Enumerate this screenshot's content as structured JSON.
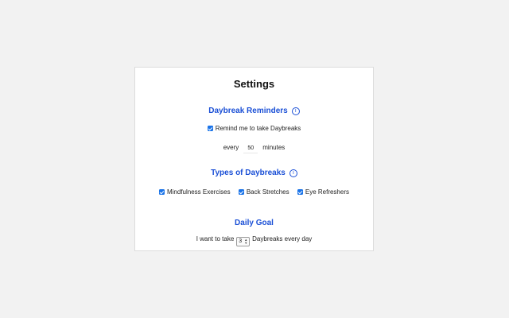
{
  "settings": {
    "title": "Settings",
    "reminders": {
      "heading": "Daybreak Reminders",
      "remind_label": "Remind me to take Daybreaks",
      "remind_checked": true,
      "every_label": "every",
      "minutes_value": "50",
      "minutes_label": "minutes"
    },
    "types": {
      "heading": "Types of Daybreaks",
      "items": [
        {
          "label": "Mindfulness Exercises",
          "checked": true
        },
        {
          "label": "Back Stretches",
          "checked": true
        },
        {
          "label": "Eye Refreshers",
          "checked": true
        }
      ]
    },
    "goal": {
      "heading": "Daily Goal",
      "prefix": "I want to take",
      "value": "3",
      "suffix": "Daybreaks every day"
    }
  },
  "colors": {
    "accent": "#1a4fd6",
    "checkbox": "#1a73e8",
    "background": "#f2f2f2",
    "panel": "#ffffff"
  },
  "icons": {
    "info": "info-circle-icon",
    "check": "checkmark-icon",
    "spinner": "up-down-arrows-icon"
  }
}
